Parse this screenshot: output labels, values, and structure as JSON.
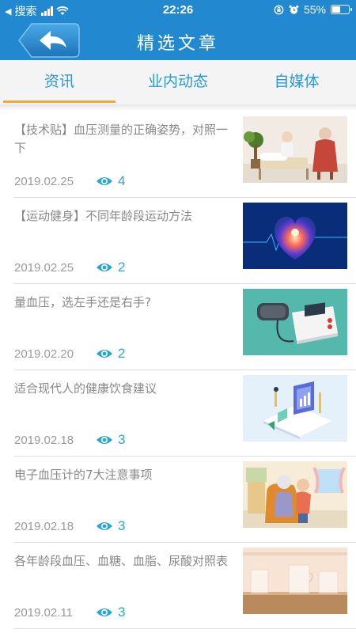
{
  "status_bar": {
    "carrier": "搜索",
    "time": "22:26",
    "battery": "55%",
    "battery_level": 0.55
  },
  "header": {
    "title": "精选文章",
    "back_icon": "back-arrow-icon"
  },
  "tabs": [
    {
      "label": "资讯",
      "active": true
    },
    {
      "label": "业内动态",
      "active": false
    },
    {
      "label": "自媒体",
      "active": false
    }
  ],
  "articles": [
    {
      "title": "【技术贴】血压测量的正确姿势，对照一下",
      "date": "2019.02.25",
      "views": "4",
      "image": "doctor-measuring-illustration"
    },
    {
      "title": "【运动健身】不同年龄段运动方法",
      "date": "2019.02.25",
      "views": "2",
      "image": "glowing-heart-illustration"
    },
    {
      "title": "量血压，选左手还是右手?",
      "date": "2019.02.20",
      "views": "2",
      "image": "blood-pressure-monitor-illustration"
    },
    {
      "title": "适合现代人的健康饮食建议",
      "date": "2019.02.18",
      "views": "3",
      "image": "isometric-stats-illustration"
    },
    {
      "title": "电子血压计的7大注意事项",
      "date": "2019.02.18",
      "views": "3",
      "image": "elderly-couple-illustration"
    },
    {
      "title": "各年龄段血压、血糖、血脂、尿酸对照表",
      "date": "2019.02.11",
      "views": "3",
      "image": "glass-cups-photo"
    }
  ],
  "colors": {
    "primary": "#2288d0",
    "tab_text": "#2a9ad6",
    "tab_indicator": "#f0a93a",
    "views": "#2aa6cf"
  }
}
